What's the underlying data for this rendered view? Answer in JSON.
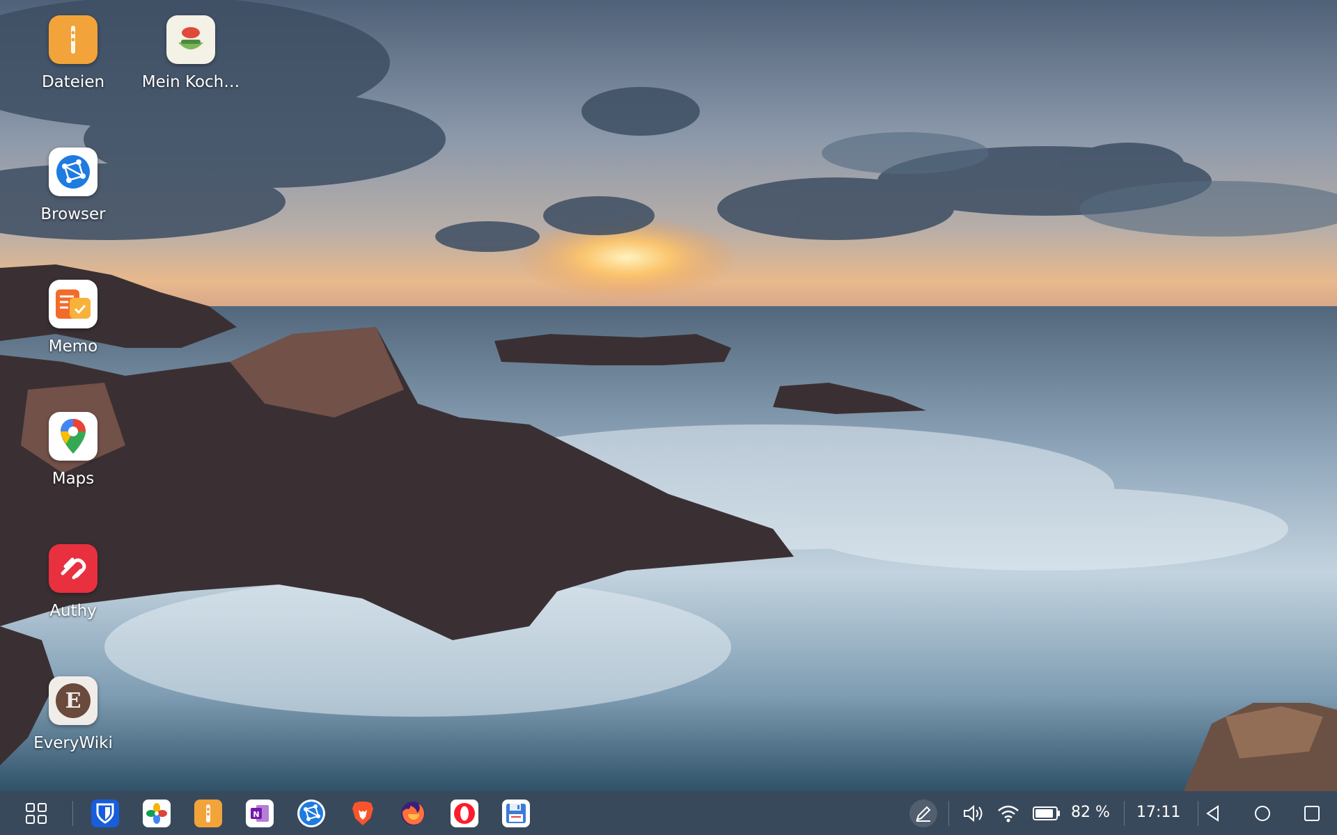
{
  "desktop": {
    "icons": [
      {
        "label": "Dateien",
        "icon": "folder-icon",
        "color": "#F2A33A"
      },
      {
        "label": "Mein Koch…",
        "icon": "cookbook-icon",
        "color": "#F4F1E6"
      },
      {
        "label": "Browser",
        "icon": "browser-globe-icon",
        "color": "#FFFFFF"
      },
      {
        "label": "Memo",
        "icon": "memo-icon",
        "color": "#FFFFFF"
      },
      {
        "label": "Maps",
        "icon": "maps-pin-icon",
        "color": "#FFFFFF"
      },
      {
        "label": "Authy",
        "icon": "authy-icon",
        "color": "#E8303F"
      },
      {
        "label": "EveryWiki",
        "icon": "everywiki-icon",
        "color": "#F0EDE8"
      }
    ]
  },
  "taskbar": {
    "launcher_icon": "app-grid-icon",
    "apps": [
      {
        "name": "bitwarden",
        "icon": "shield-icon",
        "color": "#175DDC"
      },
      {
        "name": "gallery",
        "icon": "flower-icon",
        "color": "#FFFFFF"
      },
      {
        "name": "files",
        "icon": "folder-icon",
        "color": "#F2A33A"
      },
      {
        "name": "onenote",
        "icon": "onenote-icon",
        "color": "#7719AA"
      },
      {
        "name": "browser",
        "icon": "browser-globe-icon",
        "color": "#1E7BE0"
      },
      {
        "name": "brave",
        "icon": "lion-icon",
        "color": "#FB542B"
      },
      {
        "name": "firefox",
        "icon": "firefox-icon",
        "color": "#FF7139"
      },
      {
        "name": "opera",
        "icon": "opera-icon",
        "color": "#FF1B2D"
      },
      {
        "name": "save",
        "icon": "floppy-disk-icon",
        "color": "#3D7BD9"
      }
    ],
    "tray": {
      "pen_icon": "pen-icon",
      "volume_icon": "volume-icon",
      "wifi_icon": "wifi-icon",
      "battery_icon": "battery-icon",
      "battery_percent": "82 %",
      "time": "17:11"
    },
    "nav": {
      "back_icon": "back-triangle-icon",
      "home_icon": "home-circle-icon",
      "recents_icon": "recents-square-icon"
    }
  }
}
